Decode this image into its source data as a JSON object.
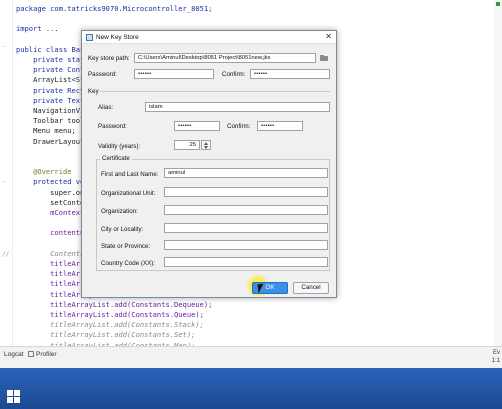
{
  "editor": {
    "lines": [
      {
        "text": "package com.tatricks9070.Microcontroller_8051;",
        "cls": "kw"
      },
      {
        "text": "",
        "cls": ""
      },
      {
        "text": "import ...",
        "cls": "kw"
      },
      {
        "text": "",
        "cls": ""
      },
      {
        "text": "public class BasicI",
        "cls": "kw"
      },
      {
        "text": "    private static",
        "cls": "kw"
      },
      {
        "text": "    private Context",
        "cls": "kw"
      },
      {
        "text": "    ArrayList<Strin",
        "cls": ""
      },
      {
        "text": "    private Recycle",
        "cls": "kw"
      },
      {
        "text": "    private TextVie",
        "cls": "kw"
      },
      {
        "text": "    NavigationView",
        "cls": ""
      },
      {
        "text": "    Toolbar toolbar",
        "cls": ""
      },
      {
        "text": "    Menu menu;",
        "cls": ""
      },
      {
        "text": "    DrawerLayout dr",
        "cls": ""
      },
      {
        "text": "",
        "cls": ""
      },
      {
        "text": "",
        "cls": ""
      },
      {
        "text": "    @Override",
        "cls": "ann"
      },
      {
        "text": "    protected void",
        "cls": "kw"
      },
      {
        "text": "        super.onCre",
        "cls": ""
      },
      {
        "text": "        setContent",
        "cls": ""
      },
      {
        "text": "        mContext =",
        "cls": "hl"
      },
      {
        "text": "",
        "cls": ""
      },
      {
        "text": "        contentnum",
        "cls": "hl"
      },
      {
        "text": "",
        "cls": ""
      },
      {
        "text": "        Contents",
        "cls": "cmt"
      },
      {
        "text": "        titleArrayL",
        "cls": "hl"
      },
      {
        "text": "        titleArrayL",
        "cls": "hl"
      },
      {
        "text": "        titleArrayL",
        "cls": "hl"
      },
      {
        "text": "        titleArrayL",
        "cls": "hl"
      },
      {
        "text": "        titleArrayList.add(Constants.Dequeue);",
        "cls": "hl"
      },
      {
        "text": "        titleArrayList.add(Constants.Queue);",
        "cls": "hl"
      },
      {
        "text": "        titleArrayList.add(Constants.Stack);",
        "cls": "cmt"
      },
      {
        "text": "        titleArrayList.add(Constants.Set);",
        "cls": "cmt"
      },
      {
        "text": "        titleArrayList.add(Constants.Map);",
        "cls": "cmt"
      }
    ]
  },
  "bottombar": {
    "logcat": "Logcat",
    "profiler": "Profiler",
    "right_top": "Ev",
    "right_bottom": "1:1"
  },
  "dialog": {
    "title": "New Key Store",
    "close": "✕",
    "key_store_path_label": "Key store path:",
    "key_store_path_value": "C:\\Users\\Aminul\\Desktop\\8051 Project\\8051new.jks",
    "password_label": "Password:",
    "password_value": "••••••",
    "confirm_label": "Confirm:",
    "confirm_value": "••••••",
    "key_section": "Key",
    "alias_label": "Alias:",
    "alias_value": "islam",
    "key_password_label": "Password:",
    "key_password_value": "••••••",
    "key_confirm_label": "Confirm:",
    "key_confirm_value": "••••••",
    "validity_label": "Validity (years):",
    "validity_value": "25",
    "certificate_title": "Certificate",
    "first_last_label": "First and Last Name:",
    "first_last_value": "aminul",
    "org_unit_label": "Organizational Unit:",
    "org_unit_value": "",
    "org_label": "Organization:",
    "org_value": "",
    "city_label": "City or Locality:",
    "city_value": "",
    "state_label": "State or Province:",
    "state_value": "",
    "country_label": "Country Code (XX):",
    "country_value": "",
    "ok_label": "OK",
    "cancel_label": "Cancel"
  },
  "colors": {
    "ok_button": "#3a8fe6",
    "taskbar": "#1f55a8",
    "cursor_highlight": "#f5e83a"
  }
}
